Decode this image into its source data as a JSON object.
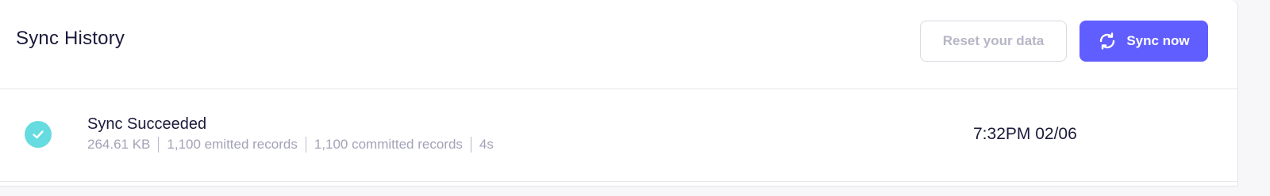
{
  "header": {
    "title": "Sync History",
    "reset_label": "Reset your data",
    "sync_label": "Sync now",
    "sync_icon": "refresh-icon"
  },
  "history": [
    {
      "status_icon": "check-circle-icon",
      "status": "Sync Succeeded",
      "size": "264.61 KB",
      "emitted": "1,100 emitted records",
      "committed": "1,100 committed records",
      "duration": "4s",
      "timestamp": "7:32PM 02/06"
    }
  ],
  "colors": {
    "accent": "#615eff",
    "success": "#66dbe0",
    "text": "#1b1a3b",
    "muted": "#a3a3b8"
  }
}
